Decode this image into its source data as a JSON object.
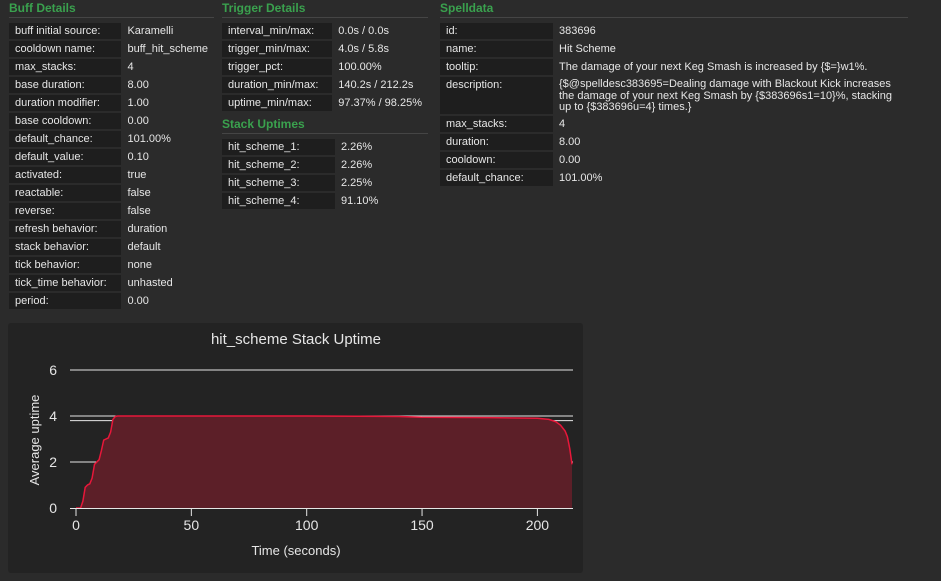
{
  "buff_details": {
    "title": "Buff Details",
    "rows": [
      {
        "key": "buff initial source:",
        "value": "Karamelli"
      },
      {
        "key": "cooldown name:",
        "value": "buff_hit_scheme"
      },
      {
        "key": "max_stacks:",
        "value": "4"
      },
      {
        "key": "base duration:",
        "value": "8.00"
      },
      {
        "key": "duration modifier:",
        "value": "1.00"
      },
      {
        "key": "base cooldown:",
        "value": "0.00"
      },
      {
        "key": "default_chance:",
        "value": "101.00%"
      },
      {
        "key": "default_value:",
        "value": "0.10"
      },
      {
        "key": "activated:",
        "value": "true"
      },
      {
        "key": "reactable:",
        "value": "false"
      },
      {
        "key": "reverse:",
        "value": "false"
      },
      {
        "key": "refresh behavior:",
        "value": "duration"
      },
      {
        "key": "stack behavior:",
        "value": "default"
      },
      {
        "key": "tick behavior:",
        "value": "none"
      },
      {
        "key": "tick_time behavior:",
        "value": "unhasted"
      },
      {
        "key": "period:",
        "value": "0.00"
      }
    ]
  },
  "trigger_details": {
    "title": "Trigger Details",
    "rows": [
      {
        "key": "interval_min/max:",
        "value": "0.0s / 0.0s"
      },
      {
        "key": "trigger_min/max:",
        "value": "4.0s / 5.8s"
      },
      {
        "key": "trigger_pct:",
        "value": "100.00%"
      },
      {
        "key": "duration_min/max:",
        "value": "140.2s / 212.2s"
      },
      {
        "key": "uptime_min/max:",
        "value": "97.37% / 98.25%"
      }
    ]
  },
  "stack_uptimes": {
    "title": "Stack Uptimes",
    "rows": [
      {
        "key": "hit_scheme_1:",
        "value": "2.26%"
      },
      {
        "key": "hit_scheme_2:",
        "value": "2.26%"
      },
      {
        "key": "hit_scheme_3:",
        "value": "2.25%"
      },
      {
        "key": "hit_scheme_4:",
        "value": "91.10%"
      }
    ]
  },
  "spelldata": {
    "title": "Spelldata",
    "rows": [
      {
        "key": "id:",
        "value": "383696"
      },
      {
        "key": "name:",
        "value": "Hit Scheme"
      },
      {
        "key": "tooltip:",
        "value": "The damage of your next Keg Smash is increased by {$=}w1%."
      },
      {
        "key": "description:",
        "value": "{$@spelldesc383695=Dealing damage with Blackout Kick increases the damage of your next Keg Smash by {$383696s1=10}%, stacking up to {$383696u=4} times.}"
      },
      {
        "key": "max_stacks:",
        "value": "4"
      },
      {
        "key": "duration:",
        "value": "8.00"
      },
      {
        "key": "cooldown:",
        "value": "0.00"
      },
      {
        "key": "default_chance:",
        "value": "101.00%"
      }
    ]
  },
  "chart_data": {
    "type": "area",
    "title": "hit_scheme Stack Uptime",
    "xlabel": "Time (seconds)",
    "ylabel": "Average uptime",
    "xlim": [
      0,
      215
    ],
    "ylim": [
      0,
      6
    ],
    "xticks": [
      0,
      50,
      100,
      150,
      200
    ],
    "yticks": [
      0,
      2,
      4,
      6
    ],
    "reference_line": 3.8,
    "grid": true,
    "colors": {
      "fill": "#5c1f28",
      "line": "#e8173a",
      "grid": "#e6e6e6"
    },
    "series": [
      {
        "x": [
          0,
          2,
          3,
          4,
          5,
          6,
          7,
          8,
          9,
          10,
          11,
          12,
          13,
          14,
          15,
          16,
          17,
          18,
          20,
          30,
          50,
          100,
          140,
          150,
          180,
          200,
          205,
          208,
          210,
          212,
          213,
          214,
          215
        ],
        "values": [
          0,
          0,
          0.3,
          0.9,
          1.0,
          1.05,
          1.3,
          1.9,
          2.0,
          2.1,
          2.5,
          2.95,
          3.0,
          3.05,
          3.3,
          3.85,
          3.98,
          4.0,
          4.0,
          4.0,
          4.0,
          4.0,
          3.98,
          3.95,
          3.93,
          3.9,
          3.85,
          3.75,
          3.6,
          3.35,
          3.1,
          2.6,
          1.9
        ]
      }
    ]
  }
}
